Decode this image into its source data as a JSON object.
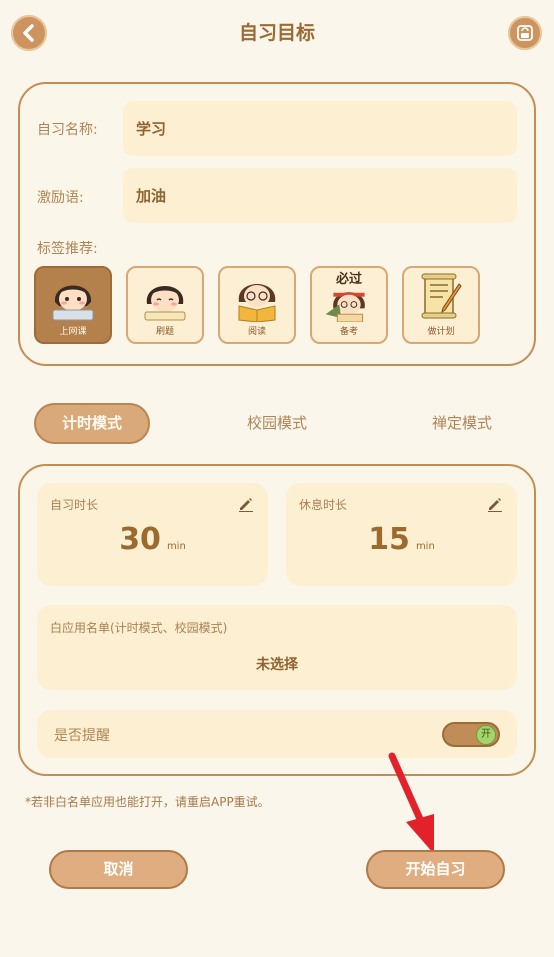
{
  "header": {
    "title": "自习目标",
    "back_icon": "chevron-left-icon",
    "right_icon": "lock-screen-icon"
  },
  "form": {
    "name_label": "自习名称:",
    "name_value": "学习",
    "motto_label": "激励语:",
    "motto_value": "加油",
    "tags_label": "标签推荐:",
    "tags": [
      {
        "label": "上网课",
        "selected": true
      },
      {
        "label": "刷题",
        "selected": false
      },
      {
        "label": "阅读",
        "selected": false
      },
      {
        "label": "备考",
        "selected": false,
        "banner": "必过"
      },
      {
        "label": "做计划",
        "selected": false
      }
    ]
  },
  "modes": [
    {
      "label": "计时模式",
      "active": true
    },
    {
      "label": "校园模式",
      "active": false
    },
    {
      "label": "禅定模式",
      "active": false
    }
  ],
  "timer": {
    "study_label": "自习时长",
    "study_value": "30",
    "study_unit": "min",
    "rest_label": "休息时长",
    "rest_value": "15",
    "rest_unit": "min",
    "whitelist_label": "白应用名单(计时模式、校园模式)",
    "whitelist_value": "未选择",
    "reminder_label": "是否提醒",
    "reminder_toggle_label": "开",
    "reminder_on": true
  },
  "note": "*若非白名单应用也能打开，请重启APP重试。",
  "actions": {
    "cancel": "取消",
    "start": "开始自习"
  },
  "colors": {
    "background": "#faf6ec",
    "accent": "#c38e55",
    "field": "#fdf0d2",
    "arrow": "#e3212a",
    "toggle_on": "#a5d46a"
  }
}
